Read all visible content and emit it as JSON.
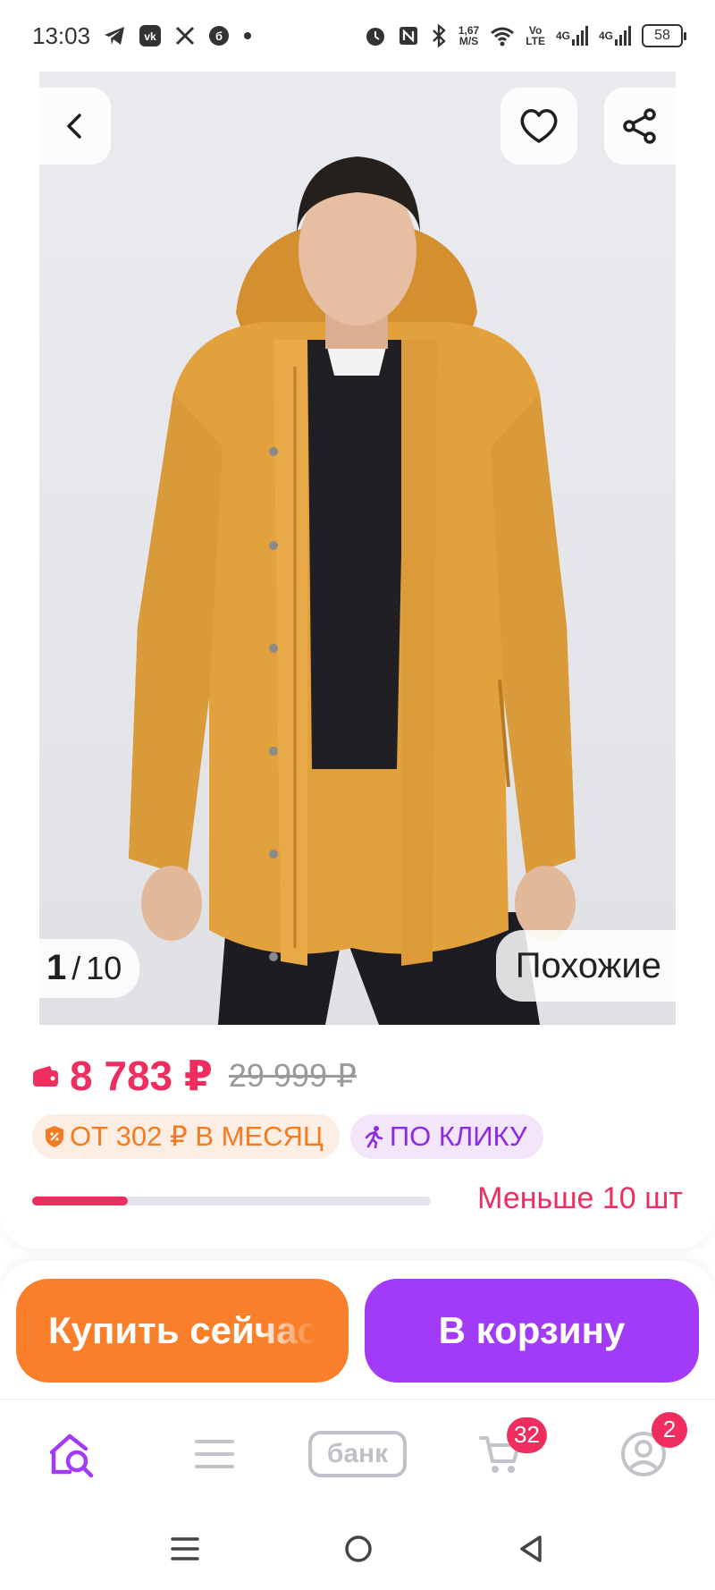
{
  "status_bar": {
    "time": "13:03",
    "app_icons": [
      "telegram-icon",
      "vk-icon",
      "x-icon",
      "b-icon",
      "dot-icon"
    ],
    "net_speed_value": "1,67",
    "net_speed_unit": "M/S",
    "volte_top": "Vo",
    "volte_bottom": "LTE",
    "signal_1": "4G",
    "signal_2": "4G",
    "battery": "58"
  },
  "gallery": {
    "current": "1",
    "separator": "/",
    "total": "10",
    "similar_label": "Похожие",
    "product_color": "#e3a13e"
  },
  "price": {
    "current": "8 783 ₽",
    "old": "29 999 ₽",
    "installment": "ОТ 302 ₽ В МЕСЯЦ",
    "one_click": "ПО КЛИКУ",
    "stock_label": "Меньше 10 шт",
    "stock_level": 0.24,
    "accent_color": "#ef2d5e"
  },
  "actions": {
    "buy_now": "Купить сейчас",
    "add_to_cart": "В корзину"
  },
  "tabbar": {
    "bank_label": "банк",
    "cart_badge": "32",
    "profile_badge": "2"
  }
}
